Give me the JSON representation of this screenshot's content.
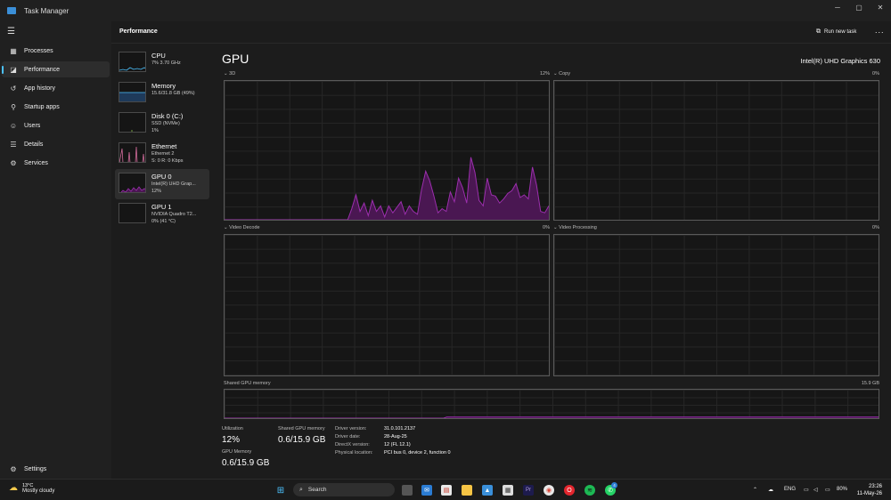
{
  "window": {
    "title": "Task Manager"
  },
  "nav": {
    "items": [
      {
        "label": "Processes",
        "icon": "processes-icon"
      },
      {
        "label": "Performance",
        "icon": "performance-icon",
        "active": true
      },
      {
        "label": "App history",
        "icon": "history-icon"
      },
      {
        "label": "Startup apps",
        "icon": "startup-icon"
      },
      {
        "label": "Users",
        "icon": "users-icon"
      },
      {
        "label": "Details",
        "icon": "details-icon"
      },
      {
        "label": "Services",
        "icon": "services-icon"
      }
    ],
    "settings_label": "Settings"
  },
  "header": {
    "title": "Performance",
    "run_task_label": "Run new task",
    "more_label": "..."
  },
  "devices": [
    {
      "name": "CPU",
      "sub1": "7% 3.70 GHz",
      "sub2": ""
    },
    {
      "name": "Memory",
      "sub1": "15.6/31.8 GB (49%)",
      "sub2": ""
    },
    {
      "name": "Disk 0 (C:)",
      "sub1": "SSD (NVMe)",
      "sub2": "1%"
    },
    {
      "name": "Ethernet",
      "sub1": "Ethernet 2",
      "sub2": "S: 0 R: 0 Kbps"
    },
    {
      "name": "GPU 0",
      "sub1": "Intel(R) UHD Grap...",
      "sub2": "12%"
    },
    {
      "name": "GPU 1",
      "sub1": "NVIDIA Quadro T2...",
      "sub2": "0% (41 °C)"
    }
  ],
  "gpu": {
    "title": "GPU",
    "model": "Intel(R) UHD Graphics 630",
    "graphs": [
      {
        "label": "3D",
        "max": "12%"
      },
      {
        "label": "Copy",
        "max": "0%"
      },
      {
        "label": "Video Decode",
        "max": "0%"
      },
      {
        "label": "Video Processing",
        "max": "0%"
      }
    ],
    "shared_memory_label": "Shared GPU memory",
    "shared_memory_max": "15.9 GB",
    "shared_memory_fraction": 0.04,
    "stats": {
      "utilization_label": "Utilization",
      "utilization": "12%",
      "shared_label": "Shared GPU memory",
      "shared": "0.6/15.9 GB",
      "gpu_memory_label": "GPU Memory",
      "gpu_memory": "0.6/15.9 GB"
    },
    "details": [
      {
        "key": "Driver version:",
        "value": "31.0.101.2137"
      },
      {
        "key": "Driver date:",
        "value": "28-Aug-25"
      },
      {
        "key": "DirectX version:",
        "value": "12 (FL 12.1)"
      },
      {
        "key": "Physical location:",
        "value": "PCI bus 0, device 2, function 0"
      }
    ]
  },
  "chart_data": {
    "type": "area",
    "title": "3D",
    "ylim": [
      0,
      100
    ],
    "values": [
      0,
      0,
      0,
      0,
      0,
      0,
      0,
      0,
      0,
      0,
      0,
      0,
      0,
      0,
      0,
      0,
      0,
      0,
      0,
      0,
      0,
      0,
      0,
      0,
      0,
      0,
      0,
      0,
      0,
      0,
      0,
      8,
      18,
      6,
      12,
      3,
      14,
      6,
      10,
      2,
      10,
      5,
      9,
      13,
      4,
      10,
      6,
      4,
      22,
      35,
      28,
      17,
      5,
      8,
      6,
      20,
      13,
      30,
      23,
      12,
      45,
      34,
      14,
      10,
      30,
      18,
      17,
      12,
      15,
      19,
      21,
      26,
      16,
      18,
      15,
      38,
      25,
      6,
      5,
      10
    ],
    "colors": {
      "line": "#9c2fae",
      "fill": "#4a1752"
    }
  },
  "shared_memory_chart": {
    "type": "area",
    "ylim": [
      0,
      100
    ],
    "values": [
      0,
      0,
      0,
      0,
      0,
      0,
      0,
      0,
      0,
      0,
      0,
      0,
      0,
      0,
      0,
      0,
      0,
      0,
      0,
      0,
      0,
      0,
      0,
      0,
      0,
      0,
      0,
      0,
      0,
      0,
      0,
      0,
      0,
      0,
      0,
      0,
      0,
      0,
      0,
      0,
      0,
      0,
      0,
      0,
      0,
      0,
      0,
      0,
      0,
      0,
      0,
      0,
      0,
      0,
      0,
      0,
      0,
      0,
      0,
      0,
      0,
      0,
      0,
      0,
      0,
      0,
      0,
      0,
      0,
      4,
      4,
      4,
      4,
      4,
      4,
      4,
      4,
      4,
      4,
      4,
      4,
      4,
      4,
      4,
      4,
      4,
      4,
      4,
      4,
      4,
      4,
      4,
      4,
      4,
      4,
      4,
      4,
      4,
      4,
      4,
      4,
      4,
      4,
      4,
      4,
      4,
      4,
      4,
      4,
      4,
      4,
      4,
      4,
      4,
      4,
      4,
      4,
      4,
      4,
      4,
      4,
      4,
      4,
      4,
      4,
      4,
      4,
      4,
      4,
      4,
      4,
      4,
      4,
      4,
      4,
      4,
      4,
      4,
      4,
      4,
      4,
      4,
      4,
      4,
      4,
      4,
      4,
      4,
      4,
      4,
      4,
      4,
      4,
      4,
      4,
      4,
      4,
      4,
      4,
      4,
      4,
      4,
      4,
      4,
      4,
      4,
      4,
      4,
      4,
      4,
      4,
      4,
      4,
      4,
      4,
      4,
      4,
      4,
      4,
      4,
      4,
      4,
      4,
      4,
      4,
      4,
      4,
      4,
      4,
      4,
      4,
      4,
      4,
      4,
      4,
      4,
      4,
      4,
      4,
      4,
      4,
      4,
      4,
      4
    ]
  },
  "taskbar": {
    "weather_temp": "13°C",
    "weather_desc": "Mostly cloudy",
    "search_label": "Search",
    "lang": "ENG",
    "battery": "80%",
    "time": "23:26",
    "date": "11-May-26",
    "whatsapp_badge": "4"
  }
}
